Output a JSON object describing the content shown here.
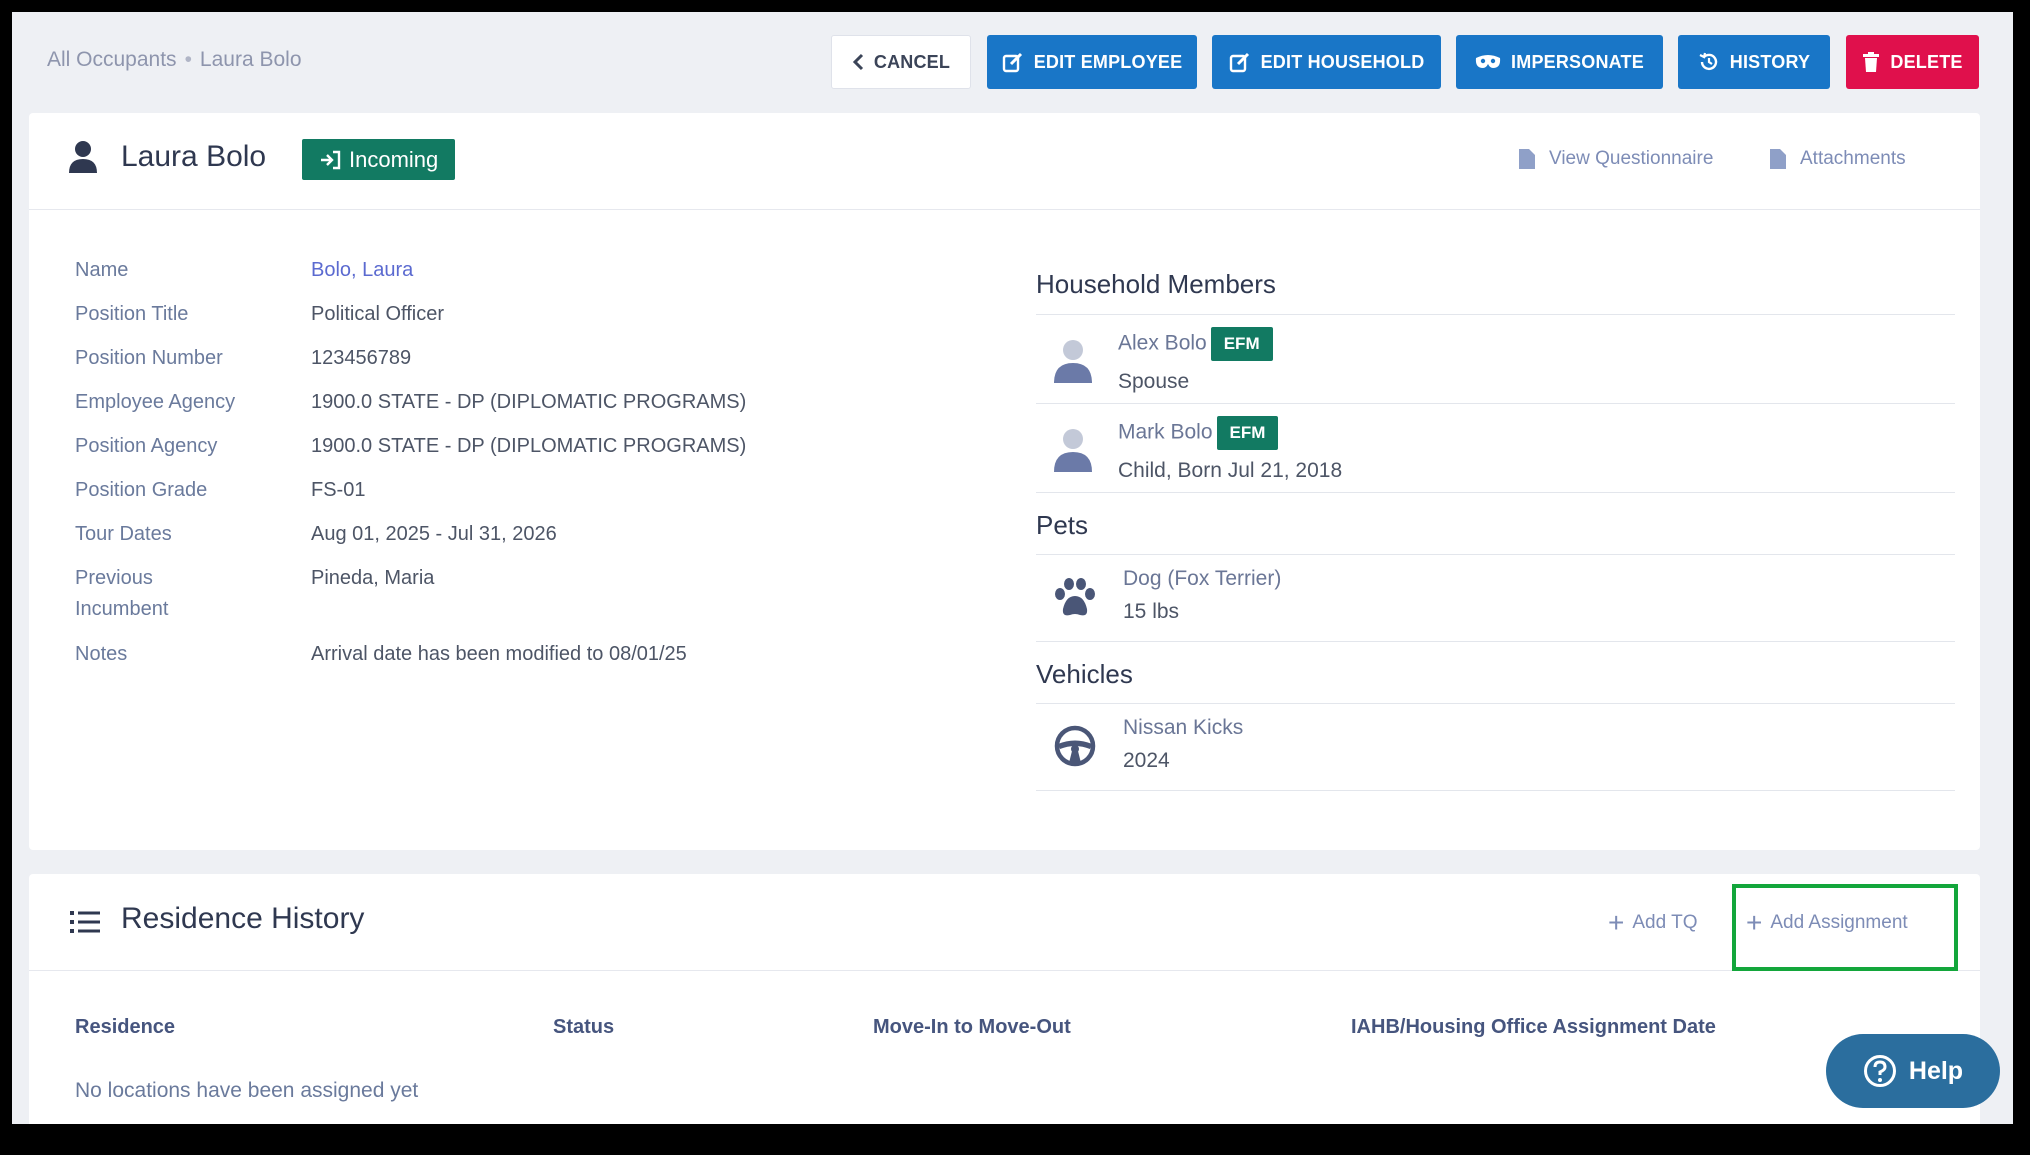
{
  "breadcrumb": {
    "root": "All Occupants",
    "current": "Laura Bolo"
  },
  "toolbar": {
    "cancel": "CANCEL",
    "edit_employee": "EDIT EMPLOYEE",
    "edit_household": "EDIT HOUSEHOLD",
    "impersonate": "IMPERSONATE",
    "history": "HISTORY",
    "delete": "DELETE"
  },
  "colors": {
    "primary": "#1976c7",
    "danger": "#e0104c",
    "success": "#127a62",
    "highlight": "#13a63b",
    "help": "#2b6e9e"
  },
  "profile": {
    "name": "Laura Bolo",
    "status": "Incoming",
    "links": {
      "questionnaire": "View Questionnaire",
      "attachments": "Attachments"
    }
  },
  "details": [
    {
      "label": "Name",
      "value": "Bolo, Laura"
    },
    {
      "label": "Position Title",
      "value": "Political Officer"
    },
    {
      "label": "Position Number",
      "value": "123456789"
    },
    {
      "label": "Employee Agency",
      "value": "1900.0 STATE - DP (DIPLOMATIC PROGRAMS)"
    },
    {
      "label": "Position Agency",
      "value": "1900.0 STATE - DP (DIPLOMATIC PROGRAMS)"
    },
    {
      "label": "Position Grade",
      "value": "FS-01"
    },
    {
      "label": "Tour Dates",
      "value": "Aug 01, 2025 - Jul 31, 2026"
    },
    {
      "label": "Previous Incumbent",
      "value": "Pineda, Maria"
    },
    {
      "label": "Notes",
      "value": "Arrival date has been modified to 08/01/25"
    }
  ],
  "household": {
    "title": "Household Members",
    "members": [
      {
        "name": "Alex Bolo",
        "badge": "EFM",
        "relation": "Spouse"
      },
      {
        "name": "Mark Bolo",
        "badge": "EFM",
        "relation": "Child, Born Jul 21, 2018"
      }
    ]
  },
  "pets": {
    "title": "Pets",
    "items": [
      {
        "name": "Dog (Fox Terrier)",
        "detail": "15 lbs"
      }
    ]
  },
  "vehicles": {
    "title": "Vehicles",
    "items": [
      {
        "name": "Nissan Kicks",
        "detail": "2024"
      }
    ]
  },
  "residence": {
    "title": "Residence History",
    "add_tq": "Add TQ",
    "add_assignment": "Add Assignment",
    "columns": [
      "Residence",
      "Status",
      "Move-In to Move-Out",
      "IAHB/Housing Office Assignment Date"
    ],
    "empty": "No locations have been assigned yet"
  },
  "help": {
    "label": "Help"
  }
}
